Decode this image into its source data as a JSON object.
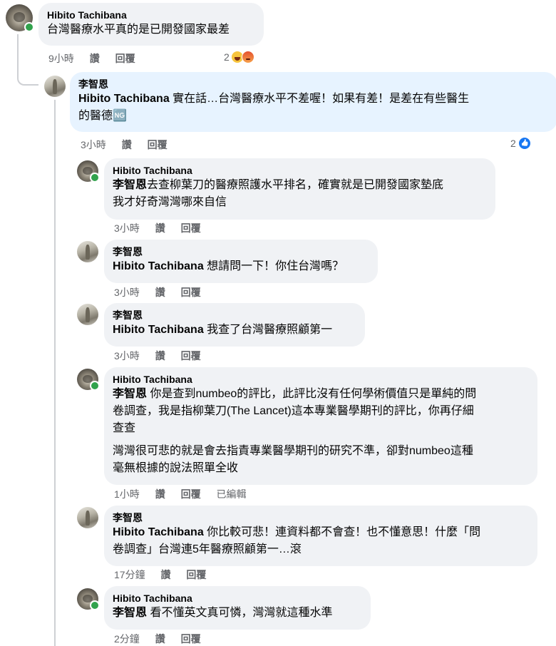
{
  "comments": [
    {
      "author": "Hibito Tachibana",
      "lines": [
        "台灣醫療水平真的是已開發國家最差"
      ],
      "time": "9小時",
      "like_label": "讚",
      "reply_label": "回覆",
      "reaction_count": "2",
      "reactions": [
        "haha-emoji",
        "angry-emoji"
      ]
    },
    {
      "author": "李智恩",
      "mention": "Hibito Tachibana",
      "lines": [
        " 實在話…台灣醫療水平不差喔！如果有差！是差在有些醫生",
        "的醫德🆖"
      ],
      "time": "3小時",
      "like_label": "讚",
      "reply_label": "回覆",
      "reaction_count": "2",
      "reactions": [
        "like-emoji"
      ]
    },
    {
      "author": "Hibito Tachibana",
      "mention": "李智恩",
      "lines": [
        "去查柳葉刀的醫療照護水平排名，確實就是已開發國家墊底",
        "我才好奇灣灣哪來自信"
      ],
      "time": "3小時",
      "like_label": "讚",
      "reply_label": "回覆"
    },
    {
      "author": "李智恩",
      "mention": "Hibito Tachibana",
      "lines": [
        " 想請問一下！你住台灣嗎？"
      ],
      "time": "3小時",
      "like_label": "讚",
      "reply_label": "回覆"
    },
    {
      "author": "李智恩",
      "mention": "Hibito Tachibana",
      "lines": [
        " 我查了台灣醫療照顧第一"
      ],
      "time": "3小時",
      "like_label": "讚",
      "reply_label": "回覆"
    },
    {
      "author": "Hibito Tachibana",
      "mention": "李智恩",
      "lines": [
        " 你是查到numbeo的評比，此評比沒有任何學術價值只是單純的問",
        "卷調查，我是指柳葉刀(The Lancet)這本專業醫學期刊的評比，你再仔細",
        "查查"
      ],
      "lines2": [
        "灣灣很可悲的就是會去指責專業醫學期刊的研究不準，卻對numbeo這種",
        "毫無根據的說法照單全收"
      ],
      "time": "1小時",
      "like_label": "讚",
      "reply_label": "回覆",
      "edited_label": "已編輯"
    },
    {
      "author": "李智恩",
      "mention": "Hibito Tachibana",
      "lines": [
        " 你比較可悲！連資料都不會查！也不懂意思！什麼「問",
        "卷調查」台灣連5年醫療照顧第一…滾"
      ],
      "time": "17分鐘",
      "like_label": "讚",
      "reply_label": "回覆"
    },
    {
      "author": "Hibito Tachibana",
      "mention": "李智恩",
      "lines": [
        " 看不懂英文真可憐，灣灣就這種水準"
      ],
      "time": "2分鐘",
      "like_label": "讚",
      "reply_label": "回覆"
    }
  ]
}
